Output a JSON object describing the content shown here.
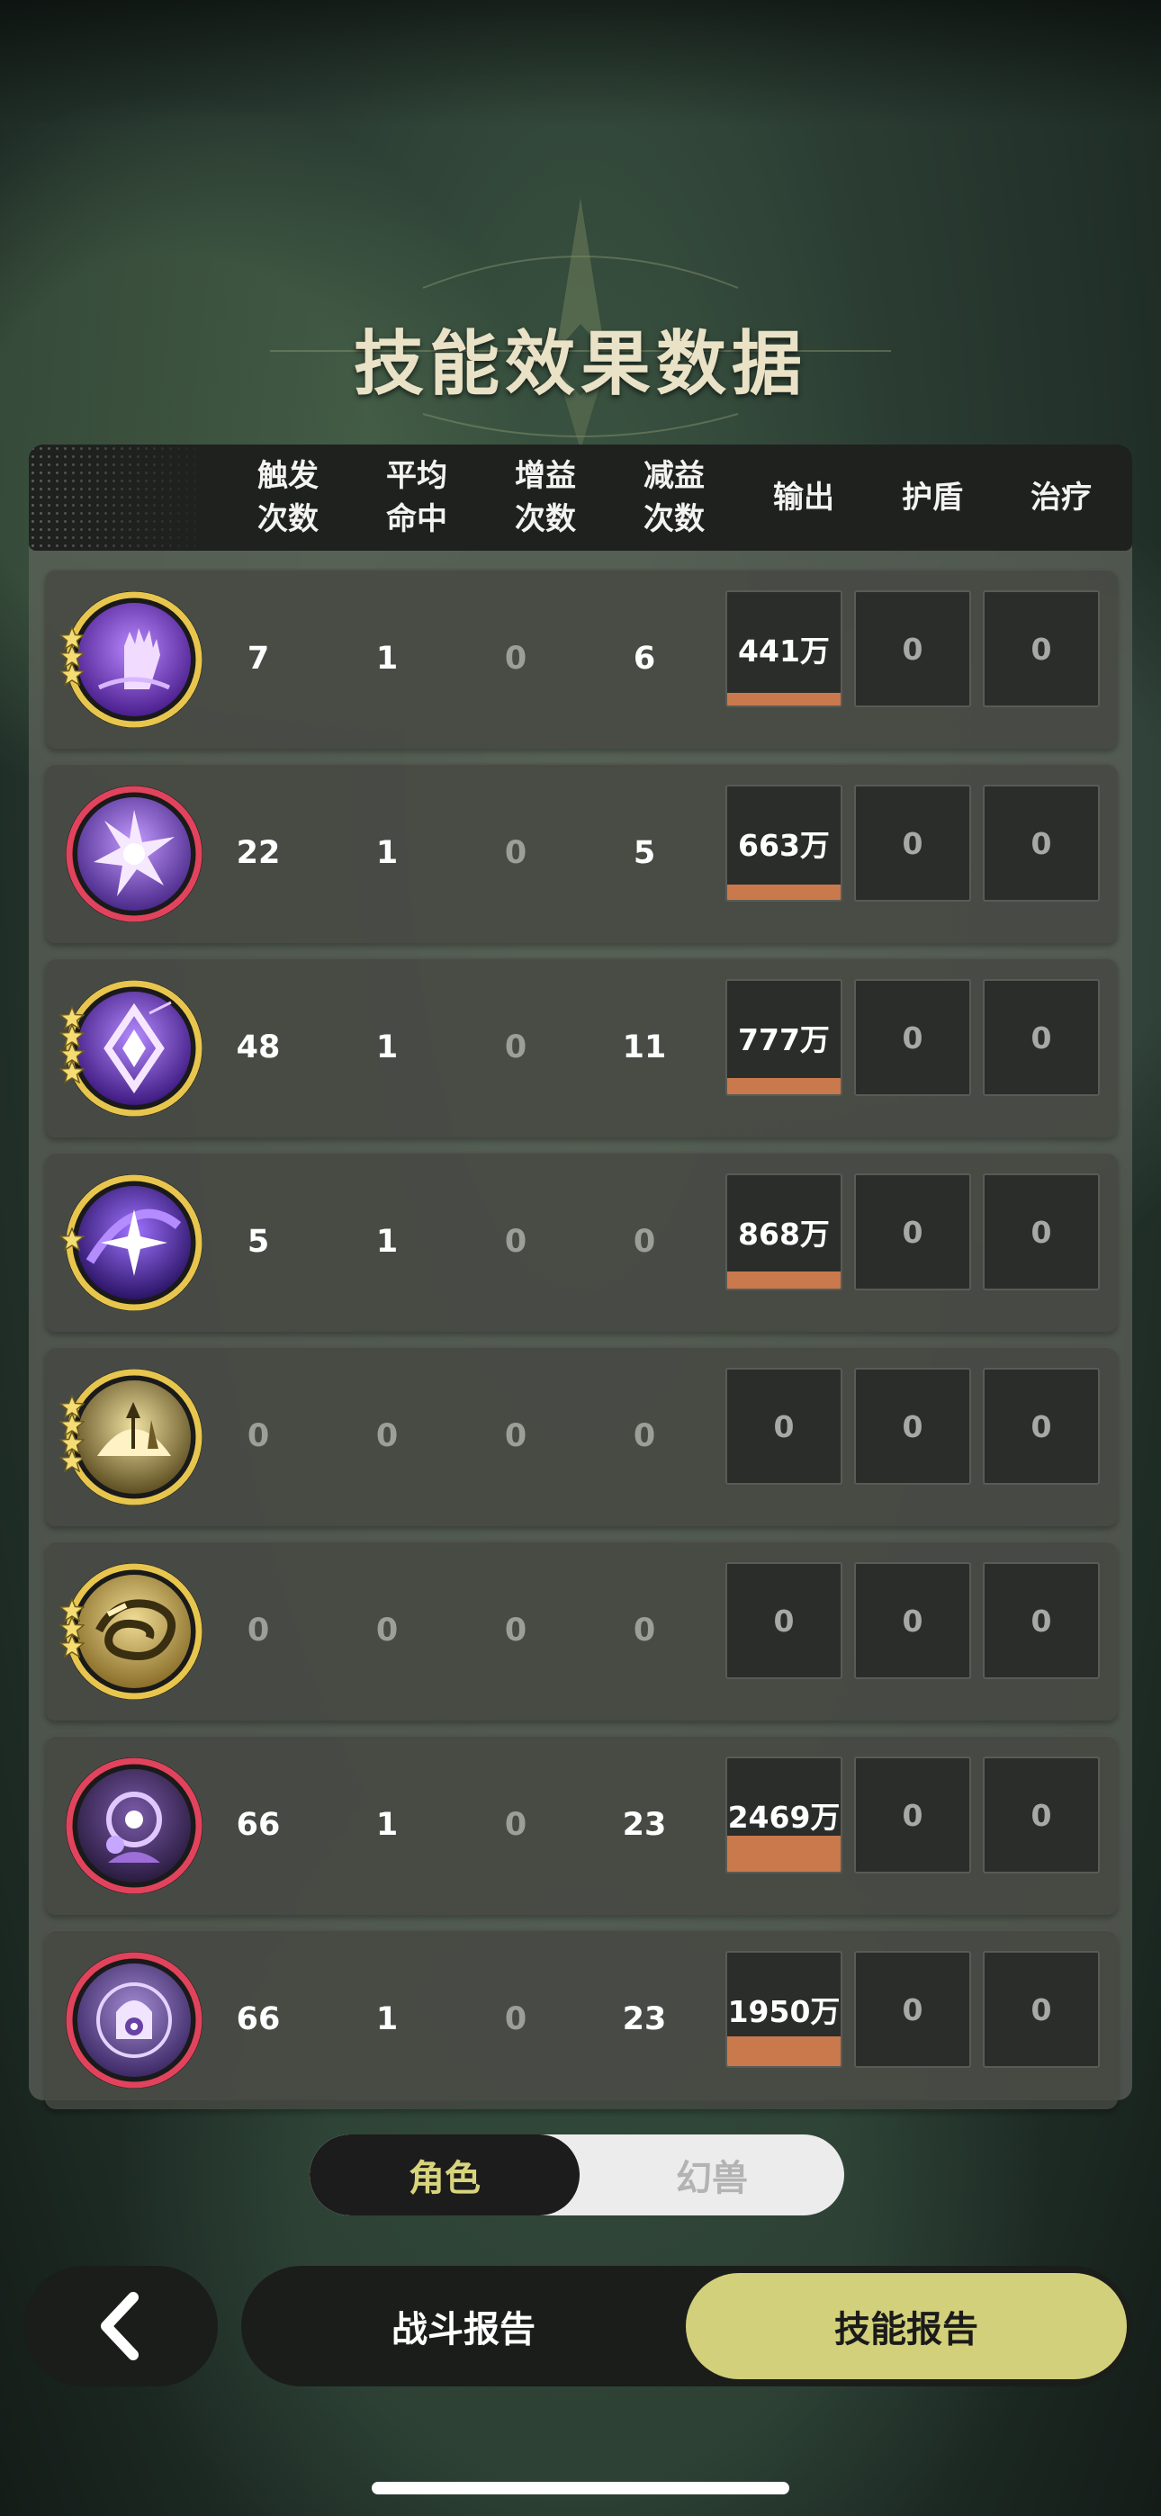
{
  "title": "技能效果数据",
  "headers": [
    "触发\n次数",
    "平均\n命中",
    "增益\n次数",
    "减益\n次数",
    "输出",
    "护盾",
    "治疗"
  ],
  "rows": [
    {
      "icon": "raised-fist-skill-icon",
      "frame": "gold",
      "stars": 3,
      "trigger": "7",
      "hit": "1",
      "buff": "0",
      "debuff": "6",
      "output": "441万",
      "output_bar": 0.18,
      "shield": "0",
      "heal": "0"
    },
    {
      "icon": "purple-burst-skill-icon",
      "frame": "red",
      "stars": 0,
      "trigger": "22",
      "hit": "1",
      "buff": "0",
      "debuff": "5",
      "output": "663万",
      "output_bar": 0.27,
      "shield": "0",
      "heal": "0"
    },
    {
      "icon": "diamond-shard-skill-icon",
      "frame": "gold",
      "stars": 4,
      "trigger": "48",
      "hit": "1",
      "buff": "0",
      "debuff": "11",
      "output": "777万",
      "output_bar": 0.31,
      "shield": "0",
      "heal": "0"
    },
    {
      "icon": "purple-star-vortex-skill-icon",
      "frame": "gold",
      "stars": 1,
      "trigger": "5",
      "hit": "1",
      "buff": "0",
      "debuff": "0",
      "output": "868万",
      "output_bar": 0.35,
      "shield": "0",
      "heal": "0"
    },
    {
      "icon": "golden-rise-skill-icon",
      "frame": "gold",
      "stars": 4,
      "trigger": "0",
      "hit": "0",
      "buff": "0",
      "debuff": "0",
      "output": "0",
      "output_bar": 0,
      "shield": "0",
      "heal": "0"
    },
    {
      "icon": "golden-swirl-skill-icon",
      "frame": "gold",
      "stars": 3,
      "trigger": "0",
      "hit": "0",
      "buff": "0",
      "debuff": "0",
      "output": "0",
      "output_bar": 0,
      "shield": "0",
      "heal": "0"
    },
    {
      "icon": "dark-mage-skill-icon",
      "frame": "red",
      "stars": 0,
      "trigger": "66",
      "hit": "1",
      "buff": "0",
      "debuff": "23",
      "output": "2469万",
      "output_bar": 1.0,
      "shield": "0",
      "heal": "0"
    },
    {
      "icon": "purple-seal-skill-icon",
      "frame": "red",
      "stars": 0,
      "trigger": "66",
      "hit": "1",
      "buff": "0",
      "debuff": "23",
      "output": "1950万",
      "output_bar": 0.79,
      "shield": "0",
      "heal": "0"
    }
  ],
  "toggle": {
    "active": "角色",
    "inactive": "幻兽"
  },
  "nav": {
    "back_icon": "chevron-left-icon",
    "battle_report": "战斗报告",
    "skill_report": "技能报告"
  },
  "colors": {
    "accent": "#d2d07a",
    "bar": "#c9794c",
    "gold_frame": "#e8c64e",
    "red_frame": "#e2435c"
  }
}
